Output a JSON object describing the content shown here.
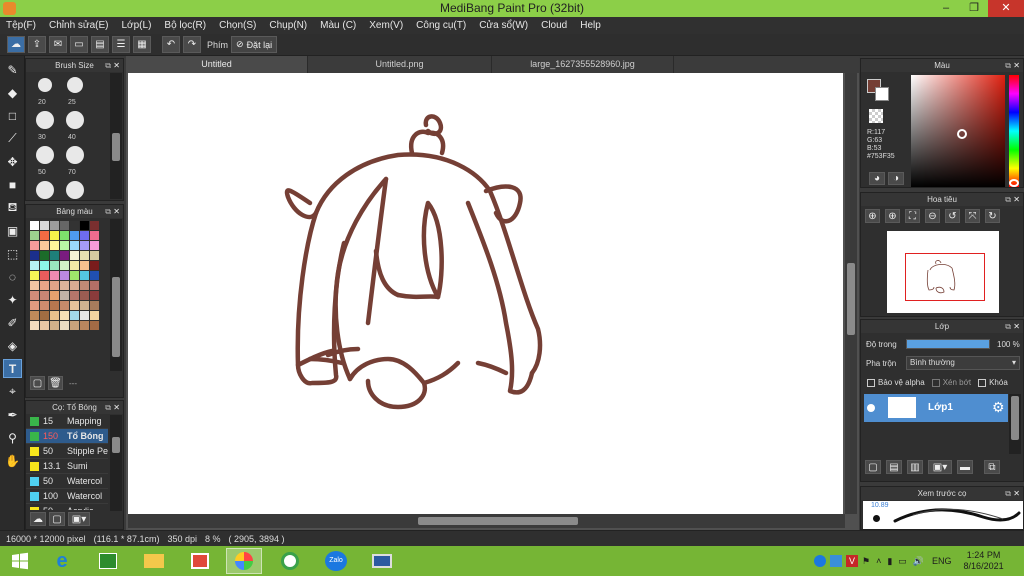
{
  "window": {
    "title": "MediBang Paint Pro (32bit)",
    "controls": [
      "–",
      "❐",
      "✕"
    ]
  },
  "menu": [
    "Tệp(F)",
    "Chỉnh sửa(E)",
    "Lớp(L)",
    "Bộ lọc(R)",
    "Chọn(S)",
    "Chụp(N)",
    "Màu (C)",
    "Xem(V)",
    "Công cụ(T)",
    "Cửa sổ(W)",
    "Cloud",
    "Help"
  ],
  "toolbar": {
    "shortcut_label": "Phím",
    "reset_label": "Đặt lại"
  },
  "tabs": [
    "Untitled",
    "Untitled.png",
    "large_1627355528960.jpg"
  ],
  "brush_size": {
    "title": "Brush Size",
    "sizes": [
      "20",
      "25",
      "30",
      "40",
      "50",
      "70",
      "",
      ""
    ]
  },
  "palette": {
    "title": "Bảng màu",
    "colors": [
      "#ffffff",
      "#d8d8d8",
      "#9c9c9c",
      "#666666",
      "#333333",
      "#000000",
      "#7a2f2f",
      "#9dd38f",
      "#f46a43",
      "#f7f34a",
      "#7ee06b",
      "#4e9bf0",
      "#6e6cf0",
      "#f06b8f",
      "#f59b9b",
      "#fac99b",
      "#fff59a",
      "#b8f7a5",
      "#9ad9fb",
      "#a59bf7",
      "#f79bd9",
      "#1b2f8c",
      "#1c6b2a",
      "#1e7f7a",
      "#7a1c7f",
      "#f5f2d6",
      "#e7e0b0",
      "#d6cba0",
      "#b6f3f3",
      "#8df5e8",
      "#9ae7c0",
      "#d3f2c8",
      "#f3e9a6",
      "#f6c28f",
      "#7a1c1c",
      "#f5f556",
      "#e85c5c",
      "#f08ab0",
      "#bb88e0",
      "#9fe66a",
      "#54c7e0",
      "#2050b0",
      "#f2c5a3",
      "#e8a488",
      "#e0a388",
      "#dcb39a",
      "#d9ab93",
      "#c28a76",
      "#b36f66",
      "#d28c7a",
      "#c98575",
      "#e6a16e",
      "#c2b2a6",
      "#b5766a",
      "#9b5c52",
      "#8a3b3b",
      "#e09a80",
      "#cf8b6e",
      "#b6774f",
      "#c78a6a",
      "#e7c39b",
      "#cfb290",
      "#a77c5c",
      "#c08a5a",
      "#a16d42",
      "#e9c28d",
      "#f6e0b5",
      "#a3d9e9",
      "#e7e7e7",
      "#f2d4a0",
      "#f3dcc0",
      "#e8c7a5",
      "#d2b08a",
      "#eadcc3",
      "#c9a27c",
      "#b8865e",
      "#a36a45"
    ],
    "footer": "---"
  },
  "brush_list": {
    "title": "Cọ: Tổ Bóng",
    "items": [
      {
        "size": "15",
        "name": "Mapping",
        "color": "#39b54a"
      },
      {
        "size": "150",
        "name": "Tổ Bóng",
        "color": "#39b54a",
        "active": true
      },
      {
        "size": "50",
        "name": "Stipple Pe",
        "color": "#f7e61c"
      },
      {
        "size": "13.1",
        "name": "Sumi",
        "color": "#f7e61c"
      },
      {
        "size": "50",
        "name": "Watercol",
        "color": "#4fd0f0"
      },
      {
        "size": "100",
        "name": "Watercol",
        "color": "#4fd0f0"
      },
      {
        "size": "50",
        "name": "Acrylic",
        "color": "#f7e61c"
      }
    ]
  },
  "color_panel": {
    "title": "Màu",
    "r": "R:117",
    "g": "G:63",
    "b": "B:53",
    "hex": "#753F35",
    "main_color": "#753f35"
  },
  "navigator": {
    "title": "Hoa tiêu"
  },
  "layer_panel": {
    "title": "Lớp",
    "opacity_label": "Độ trong",
    "opacity_value": "100 %",
    "opacity": 1.0,
    "blend_label": "Pha trộn",
    "blend_value": "Bình thường",
    "protect_alpha": "Bảo vệ alpha",
    "clipping": "Xén bớt",
    "lock": "Khóa",
    "layer_name": "Lớp1"
  },
  "brush_preview": {
    "title": "Xem trước cọ",
    "size": "10.89"
  },
  "status": {
    "dimensions": "16000 * 12000 pixel",
    "physical": "(116.1 * 87.1cm)",
    "dpi": "350 dpi",
    "zoom": "8 %",
    "coords": "( 2905, 3894 )"
  },
  "taskbar": {
    "lang": "ENG",
    "time": "1:24 PM",
    "date": "8/16/2021",
    "zalo": "Zalo"
  },
  "colors": {
    "titlebar": "#8ccf48",
    "taskbar": "#76b535",
    "accent": "#3b6ea5",
    "stroke": "#753f35"
  }
}
